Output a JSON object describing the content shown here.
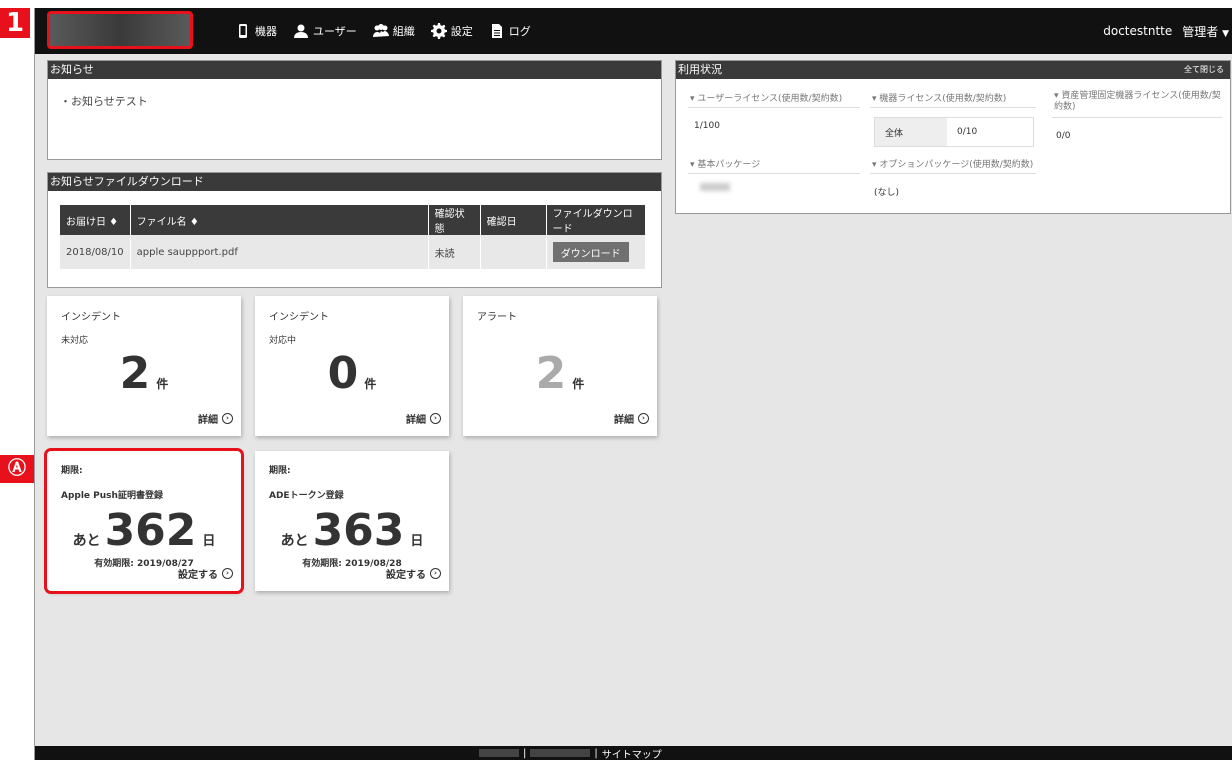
{
  "callouts": {
    "one": "1",
    "a": "Ⓐ"
  },
  "header": {
    "nav": [
      {
        "label": "機器",
        "icon": "phone-icon"
      },
      {
        "label": "ユーザー",
        "icon": "person-icon"
      },
      {
        "label": "組織",
        "icon": "group-icon"
      },
      {
        "label": "設定",
        "icon": "gear-icon"
      },
      {
        "label": "ログ",
        "icon": "document-icon"
      }
    ],
    "username": "doctestntte",
    "role": "管理者"
  },
  "news": {
    "title": "お知らせ",
    "items": [
      "・お知らせテスト"
    ]
  },
  "files": {
    "title": "お知らせファイルダウンロード",
    "columns": [
      "お届け日 ♦",
      "ファイル名 ♦",
      "確認状態",
      "確認日",
      "ファイルダウンロード"
    ],
    "rows": [
      {
        "date": "2018/08/10",
        "filename": "apple sauppport.pdf",
        "status": "未読",
        "confirmed": "",
        "button": "ダウンロード"
      }
    ]
  },
  "cards": [
    {
      "title": "インシデント",
      "sub": "未対応",
      "count": "2",
      "unit": "件",
      "link": "詳細"
    },
    {
      "title": "インシデント",
      "sub": "対応中",
      "count": "0",
      "unit": "件",
      "link": "詳細"
    },
    {
      "title": "アラート",
      "sub": "",
      "count": "2",
      "unit": "件",
      "link": "詳細"
    }
  ],
  "expiry_cards": [
    {
      "label": "期限:",
      "name": "Apple Push証明書登録",
      "prefix": "あと",
      "days": "362",
      "suffix": "日",
      "expiry": "有効期限: 2019/08/27",
      "link": "設定する"
    },
    {
      "label": "期限:",
      "name": "ADEトークン登録",
      "prefix": "あと",
      "days": "363",
      "suffix": "日",
      "expiry": "有効期限: 2019/08/28",
      "link": "設定する"
    }
  ],
  "usage": {
    "title": "利用状況",
    "close_all": "全て閉じる",
    "user_license_label": "▾ ユーザーライセンス(使用数/契約数)",
    "user_license_value": "1/100",
    "device_license_label": "▾ 機器ライセンス(使用数/契約数)",
    "device_all_key": "全体",
    "device_all_value": "0/10",
    "asset_license_label": "▾ 資産管理固定機器ライセンス(使用数/契約数)",
    "asset_license_value": "0/0",
    "base_package_label": "▾ 基本パッケージ",
    "option_package_label": "▾ オプションパッケージ(使用数/契約数)",
    "option_package_value": "(なし)"
  },
  "footer": {
    "separator": "|",
    "sitemap": "サイトマップ"
  }
}
